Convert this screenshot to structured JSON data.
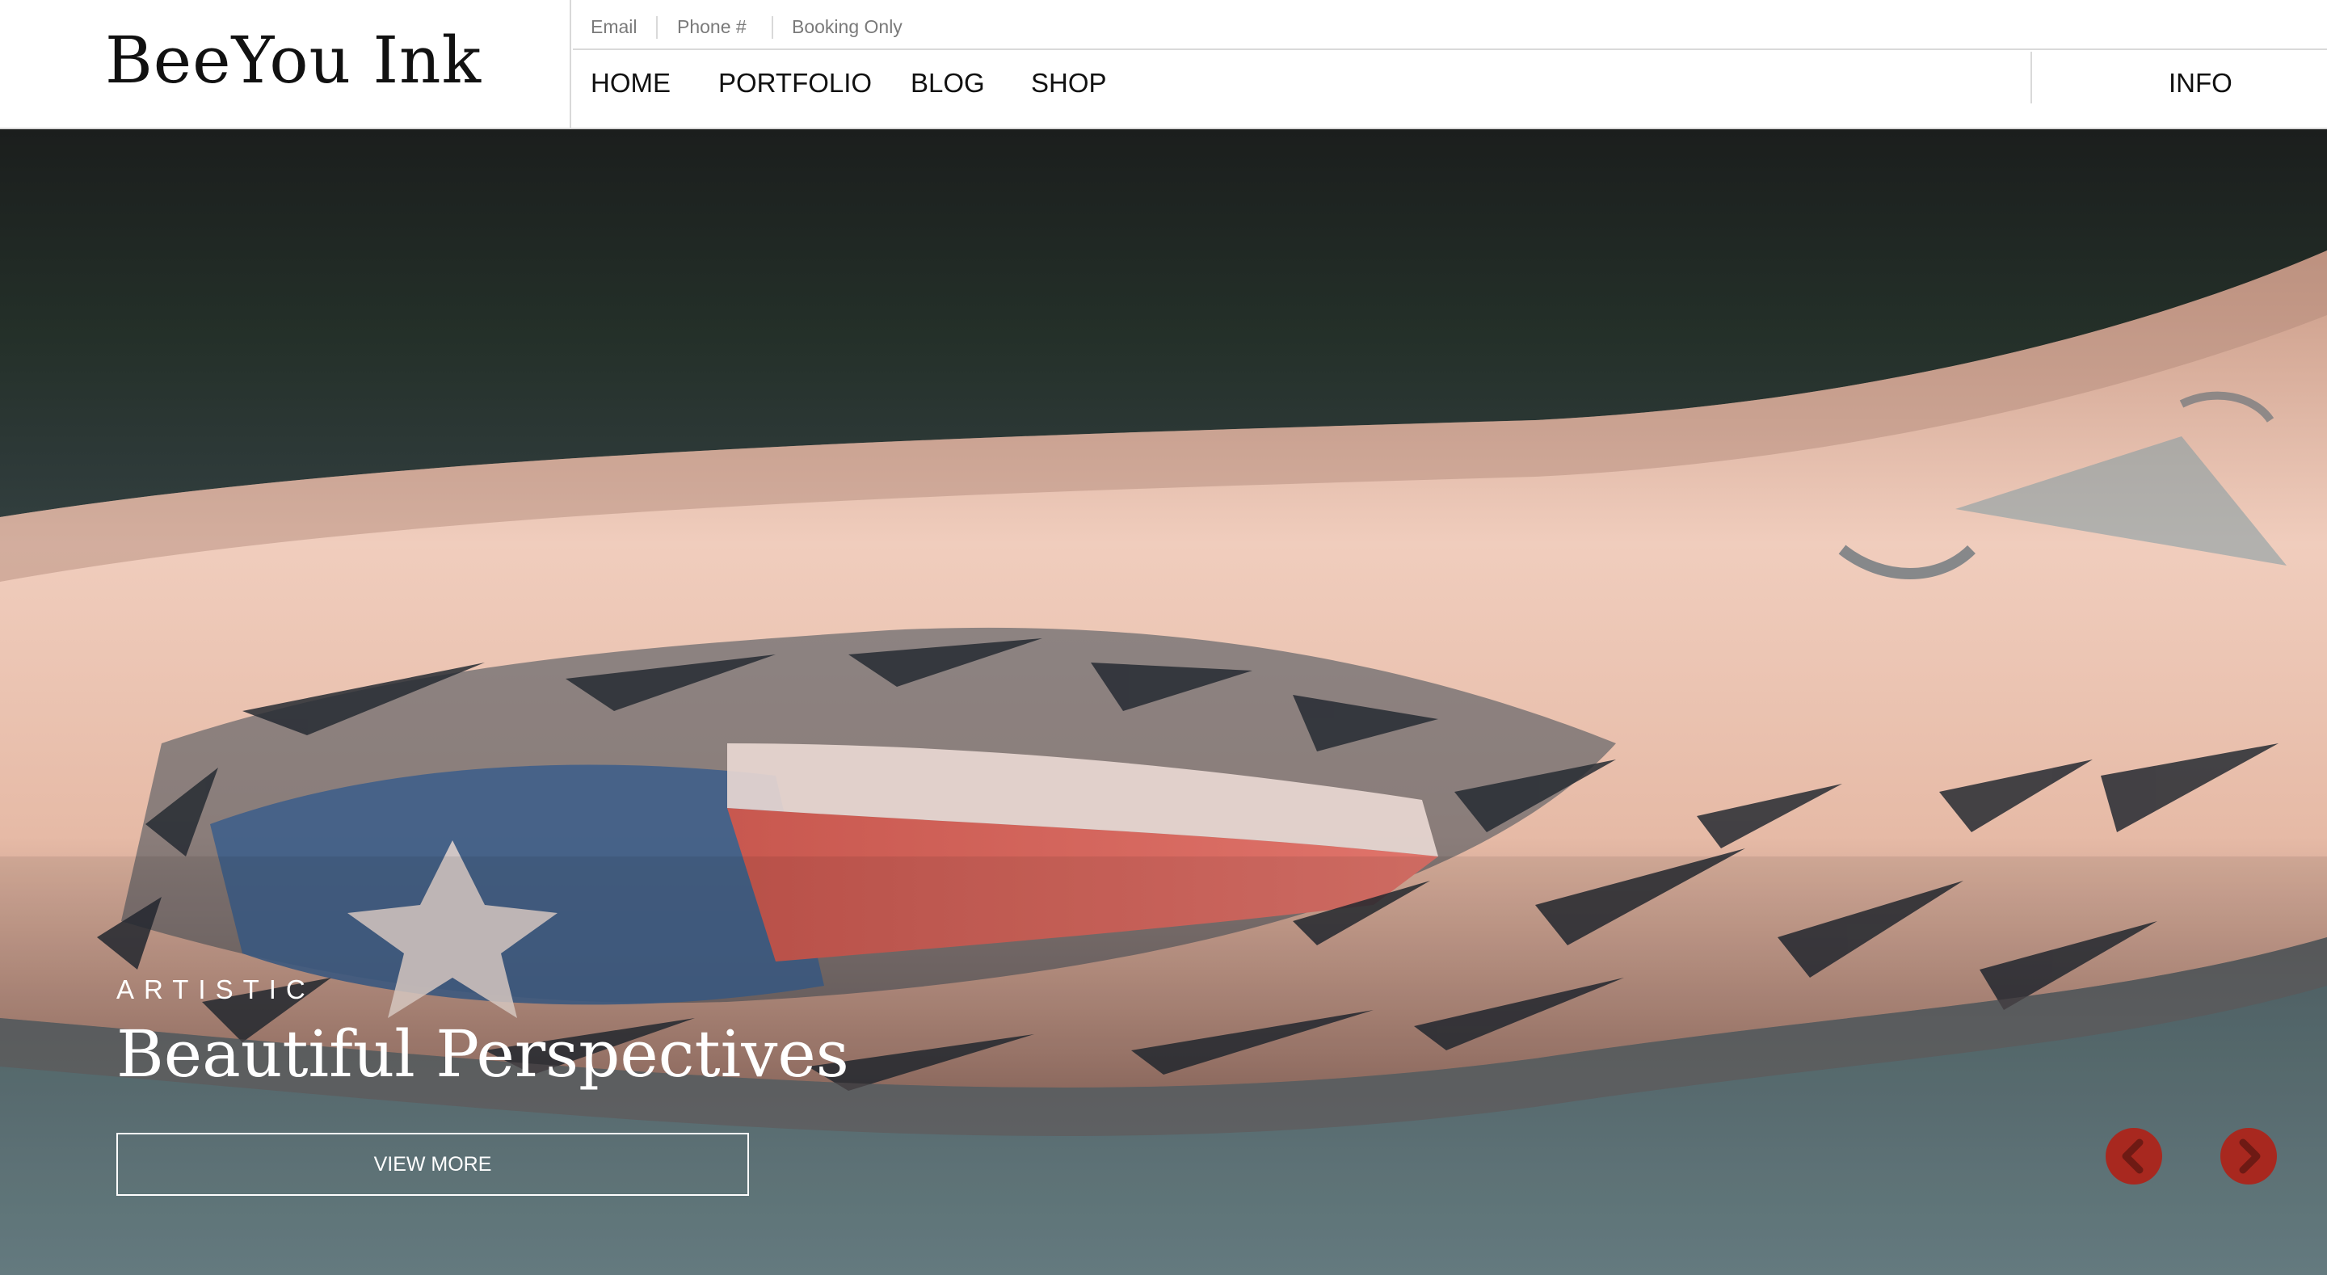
{
  "header": {
    "logo_text": "BeeYou  Ink",
    "topbar": {
      "email": "Email",
      "phone": "Phone #",
      "booking": "Booking Only"
    },
    "nav": {
      "home": "HOME",
      "portfolio": "PORTFOLIO",
      "blog": "BLOG",
      "shop": "SHOP",
      "info": "INFO"
    }
  },
  "hero": {
    "image": "tattoo-arm-torn-skin-flag",
    "eyebrow": "ARTISTIC",
    "title": "Beautiful Perspectives",
    "button_label": "VIEW MORE",
    "prev_icon": "chevron-left-icon",
    "next_icon": "chevron-right-icon",
    "arrow_color": "#a8281f"
  }
}
